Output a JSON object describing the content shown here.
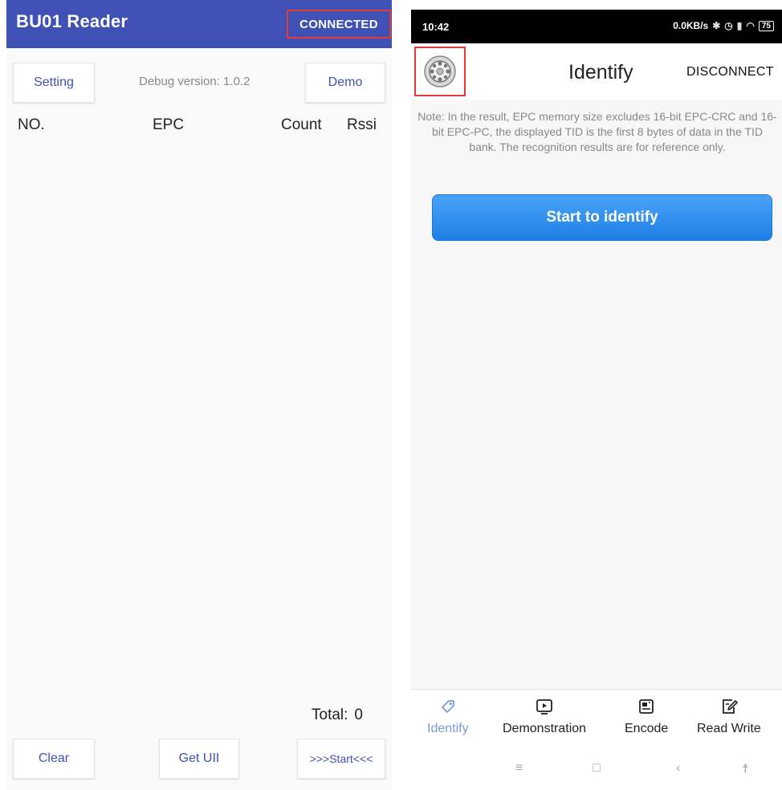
{
  "left_app": {
    "title": "BU01 Reader",
    "status": "CONNECTED",
    "setting_label": "Setting",
    "debug_version": "Debug version: 1.0.2",
    "demo_label": "Demo",
    "columns": [
      "NO.",
      "EPC",
      "Count",
      "Rssi"
    ],
    "total_label": "Total:",
    "total_value": "0",
    "clear_label": "Clear",
    "get_uii_label": "Get UII",
    "start_label": ">>>Start<<<",
    "colors": {
      "appbar": "#3f51b5",
      "accent": "#3f51b5",
      "highlight": "#e53935"
    }
  },
  "right_app": {
    "status_bar": {
      "time": "10:42",
      "speed": "0.0KB/s",
      "battery": "75"
    },
    "toolbar": {
      "settings_icon": "gear-icon",
      "title": "Identify",
      "disconnect_label": "DISCONNECT"
    },
    "note": "Note: In the result, EPC memory size excludes 16-bit EPC-CRC and 16-bit EPC-PC, the displayed TID is the first 8 bytes of data in the TID bank. The recognition results are for reference only.",
    "identify_button_label": "Start to identify",
    "bottom_nav": [
      {
        "label": "Identify",
        "icon": "tag-icon",
        "active": true
      },
      {
        "label": "Demonstration",
        "icon": "play-icon"
      },
      {
        "label": "Encode",
        "icon": "encode-icon"
      },
      {
        "label": "Read Write",
        "icon": "edit-icon"
      }
    ],
    "system_nav": {
      "menu": "≡",
      "home": "□",
      "back": "‹",
      "accessibility": "☨"
    },
    "colors": {
      "button": "#1e7fe5",
      "active_tab": "#7a9bd6",
      "highlight": "#e53935"
    }
  }
}
